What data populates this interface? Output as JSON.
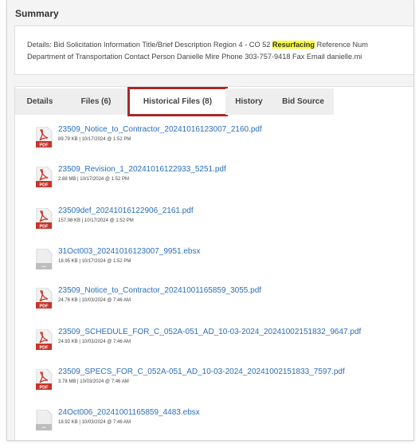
{
  "summary": {
    "title": "Summary",
    "details_line1_pre": "Details: Bid Solicitation Information Title/Brief Description Region 4 - CO 52 ",
    "details_line1_highlight": "Resurfacing",
    "details_line1_post": " Reference Num",
    "details_line2": "Department of Transportation Contact Person Danielle Mire Phone 303-757-9418 Fax Email danielle.mi"
  },
  "tabs": [
    {
      "label": "Details"
    },
    {
      "label": "Files (6)"
    },
    {
      "label": "Historical Files (8)",
      "active": true
    },
    {
      "label": "History"
    },
    {
      "label": "Bid Source"
    }
  ],
  "colors": {
    "link": "#2a6ebb",
    "active_tab_border": "#a52a2a",
    "highlight": "#ffff2b",
    "pdf_red": "#c8342a"
  },
  "files": [
    {
      "name": "23509_Notice_to_Contractor_20241016123007_2160.pdf",
      "meta": "89.79 KB | 10/17/2024 @ 1:52 PM",
      "icon": "pdf-icon",
      "icon_label": "PDF"
    },
    {
      "name": "23509_Revision_1_20241016122933_5251.pdf",
      "meta": "2.88 MB | 10/17/2024 @ 1:52 PM",
      "icon": "pdf-icon",
      "icon_label": "PDF"
    },
    {
      "name": "23509def_20241016122906_2161.pdf",
      "meta": "157.98 KB | 10/17/2024 @ 1:52 PM",
      "icon": "pdf-icon",
      "icon_label": "PDF"
    },
    {
      "name": "31Oct003_20241016123007_9951.ebsx",
      "meta": "18.95 KB | 10/17/2024 @ 1:52 PM",
      "icon": "generic-file-icon",
      "icon_label": "•••"
    },
    {
      "name": "23509_Notice_to_Contractor_20241001165859_3055.pdf",
      "meta": "24.76 KB | 10/03/2024 @ 7:46 AM",
      "icon": "pdf-icon",
      "icon_label": "PDF"
    },
    {
      "name": "23509_SCHEDULE_FOR_C_052A-051_AD_10-03-2024_20241002151832_9647.pdf",
      "meta": "24.93 KB | 10/03/2024 @ 7:46 AM",
      "icon": "pdf-icon",
      "icon_label": "PDF"
    },
    {
      "name": "23509_SPECS_FOR_C_052A-051_AD_10-03-2024_20241002151833_7597.pdf",
      "meta": "3.78 MB | 10/03/2024 @ 7:46 AM",
      "icon": "pdf-icon",
      "icon_label": "PDF"
    },
    {
      "name": "24Oct006_20241001165859_4483.ebsx",
      "meta": "18.92 KB | 10/03/2024 @ 7:46 AM",
      "icon": "generic-file-icon",
      "icon_label": "•••"
    }
  ]
}
